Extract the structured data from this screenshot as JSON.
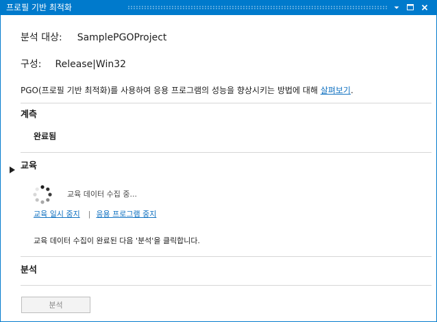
{
  "window": {
    "title": "프로필 기반 최적화",
    "accent_color": "#007acc",
    "buttons": [
      "dropdown-icon",
      "maximize-icon",
      "close-icon"
    ]
  },
  "summary": {
    "target_label": "분석 대상:",
    "target_value": "SamplePGOProject",
    "config_label": "구성:",
    "config_value": "Release|Win32"
  },
  "info": {
    "text": "PGO(프로필 기반 최적화)를 사용하여 응용 프로그램의 성능을 향상시키는 방법에 대해 ",
    "link": "살펴보기",
    "suffix": "."
  },
  "sections": {
    "measure": {
      "title": "계측",
      "status": "완료됨"
    },
    "train": {
      "title": "교육",
      "expand_icon": "expanded-triangle-icon",
      "progress_text": "교육 데이터 수집 중...",
      "pause_link": "교육 일시 중지",
      "separator": "|",
      "stop_link": "응용 프로그램 중지",
      "instruction": "교육 데이터 수집이 완료된 다음 '분석'을 클릭합니다."
    },
    "analyze": {
      "title": "분석",
      "button_label": "분석"
    }
  }
}
